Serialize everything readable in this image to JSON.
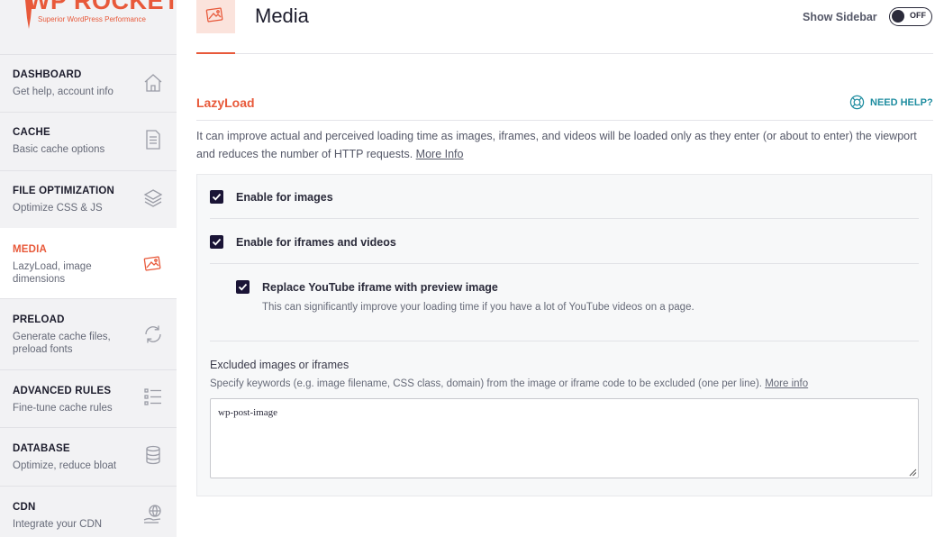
{
  "brand": {
    "name": "WP ROCKET",
    "tagline": "Superior WordPress Performance",
    "accent_color": "#e8593a"
  },
  "sidebar": {
    "items": [
      {
        "title": "DASHBOARD",
        "desc": "Get help, account info",
        "icon": "home-icon"
      },
      {
        "title": "CACHE",
        "desc": "Basic cache options",
        "icon": "document-icon"
      },
      {
        "title": "FILE OPTIMIZATION",
        "desc": "Optimize CSS & JS",
        "icon": "layers-icon"
      },
      {
        "title": "MEDIA",
        "desc": "LazyLoad, image dimensions",
        "icon": "images-icon",
        "active": true
      },
      {
        "title": "PRELOAD",
        "desc": "Generate cache files, preload fonts",
        "icon": "refresh-icon"
      },
      {
        "title": "ADVANCED RULES",
        "desc": "Fine-tune cache rules",
        "icon": "list-icon"
      },
      {
        "title": "DATABASE",
        "desc": "Optimize, reduce bloat",
        "icon": "database-icon"
      },
      {
        "title": "CDN",
        "desc": "Integrate your CDN",
        "icon": "cdn-icon"
      }
    ]
  },
  "header": {
    "title": "Media",
    "show_sidebar_label": "Show Sidebar",
    "toggle_label": "OFF"
  },
  "section": {
    "title": "LazyLoad",
    "help_label": "NEED HELP?",
    "description": "It can improve actual and perceived loading time as images, iframes, and videos will be loaded only as they enter (or about to enter) the viewport and reduces the number of HTTP requests.",
    "more_info": "More Info"
  },
  "options": [
    {
      "label": "Enable for images",
      "checked": true
    },
    {
      "label": "Enable for iframes and videos",
      "checked": true
    },
    {
      "label": "Replace YouTube iframe with preview image",
      "desc": "This can significantly improve your loading time if you have a lot of YouTube videos on a page.",
      "checked": true
    }
  ],
  "excluded": {
    "title": "Excluded images or iframes",
    "desc": "Specify keywords (e.g. image filename, CSS class, domain) from the image or iframe code to be excluded (one per line).",
    "more_info": "More info",
    "value": "wp-post-image"
  }
}
